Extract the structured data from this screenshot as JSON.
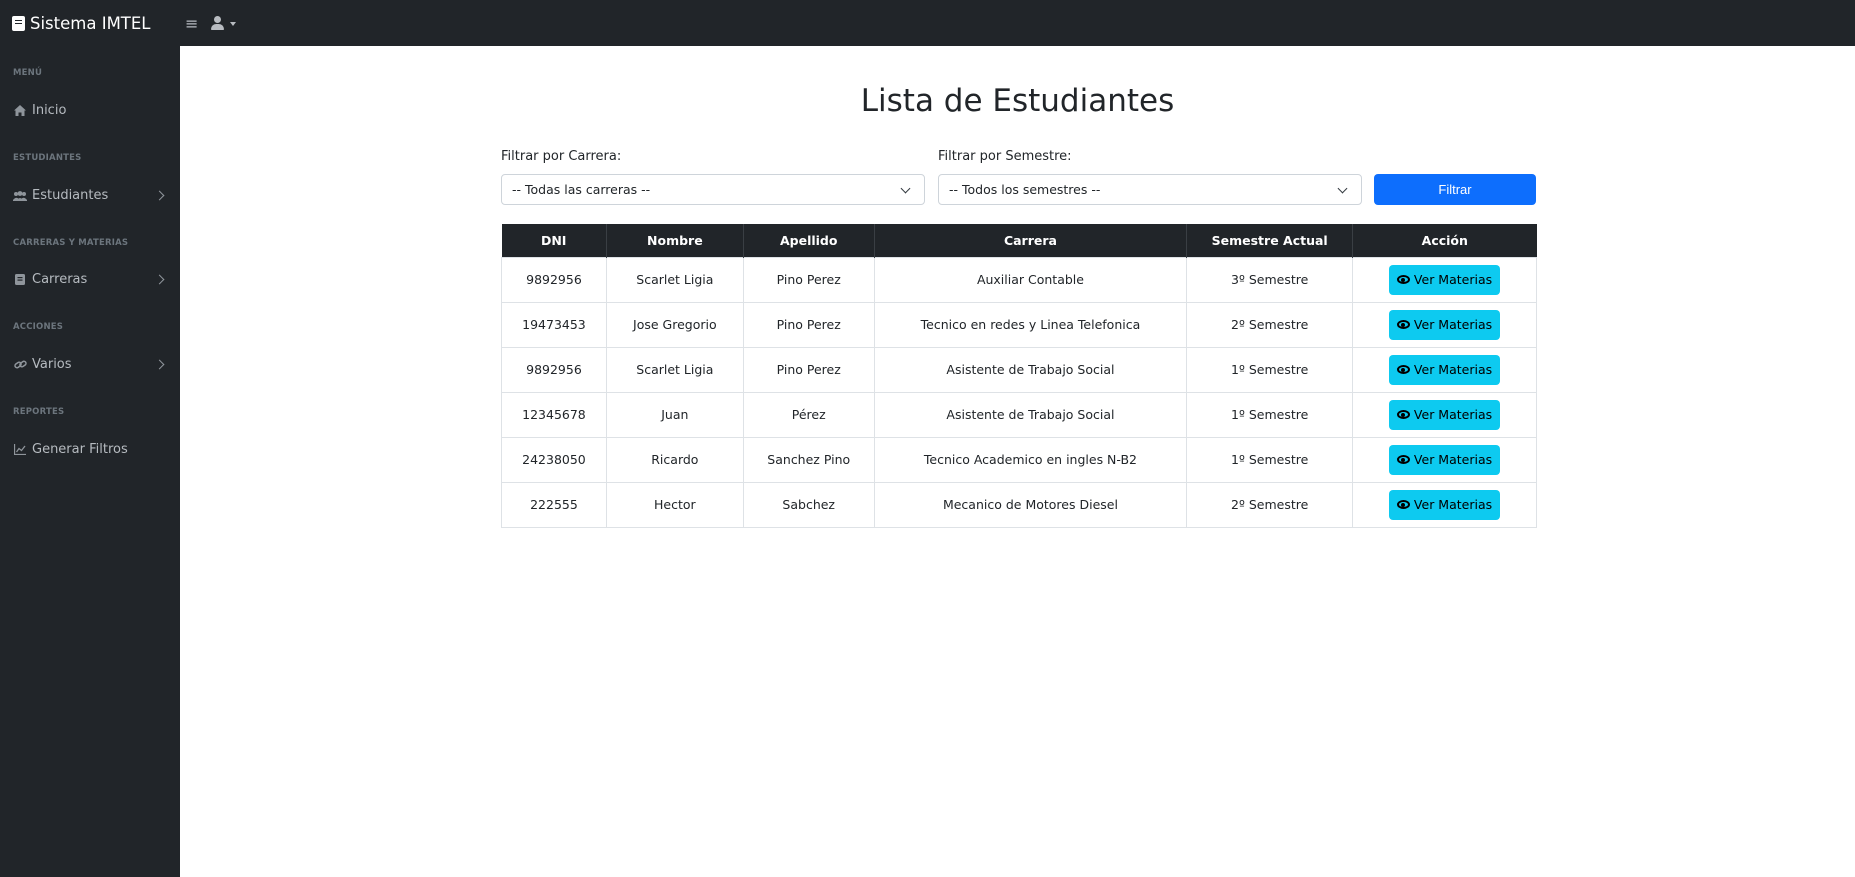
{
  "app": {
    "brand": "Sistema IMTEL",
    "toggle_glyph": "≡"
  },
  "sidebar": {
    "sections": [
      {
        "heading": "MENÚ",
        "item": {
          "label": "Inicio",
          "icon": "home-icon",
          "has_submenu": false
        }
      },
      {
        "heading": "ESTUDIANTES",
        "item": {
          "label": "Estudiantes",
          "icon": "users-icon",
          "has_submenu": true
        }
      },
      {
        "heading": "CARRERAS Y MATERIAS",
        "item": {
          "label": "Carreras",
          "icon": "book-icon",
          "has_submenu": true
        }
      },
      {
        "heading": "ACCIONES",
        "item": {
          "label": "Varios",
          "icon": "link-icon",
          "has_submenu": true
        }
      },
      {
        "heading": "REPORTES",
        "item": {
          "label": "Generar Filtros",
          "icon": "chart-icon",
          "has_submenu": false
        }
      }
    ]
  },
  "main": {
    "title": "Lista de Estudiantes",
    "filters": {
      "carrera_label": "Filtrar por Carrera:",
      "carrera_value": "-- Todas las carreras --",
      "semestre_label": "Filtrar por Semestre:",
      "semestre_value": "-- Todos los semestres --",
      "button_label": "Filtrar"
    },
    "table": {
      "headers": [
        "DNI",
        "Nombre",
        "Apellido",
        "Carrera",
        "Semestre Actual",
        "Acción"
      ],
      "action_label": "Ver Materias",
      "rows": [
        [
          "9892956",
          "Scarlet Ligia",
          "Pino Perez",
          "Auxiliar Contable",
          "3º Semestre"
        ],
        [
          "19473453",
          "Jose Gregorio",
          "Pino Perez",
          "Tecnico en redes y Linea Telefonica",
          "2º Semestre"
        ],
        [
          "9892956",
          "Scarlet Ligia",
          "Pino Perez",
          "Asistente de Trabajo Social",
          "1º Semestre"
        ],
        [
          "12345678",
          "Juan",
          "Pérez",
          "Asistente de Trabajo Social",
          "1º Semestre"
        ],
        [
          "24238050",
          "Ricardo",
          "Sanchez Pino",
          "Tecnico Academico en ingles N-B2",
          "1º Semestre"
        ],
        [
          "222555",
          "Hector",
          "Sabchez",
          "Mecanico de Motores Diesel",
          "2º Semestre"
        ]
      ]
    }
  },
  "colors": {
    "dark": "#212529",
    "primary": "#0d6efd",
    "info": "#0dcaf0"
  }
}
